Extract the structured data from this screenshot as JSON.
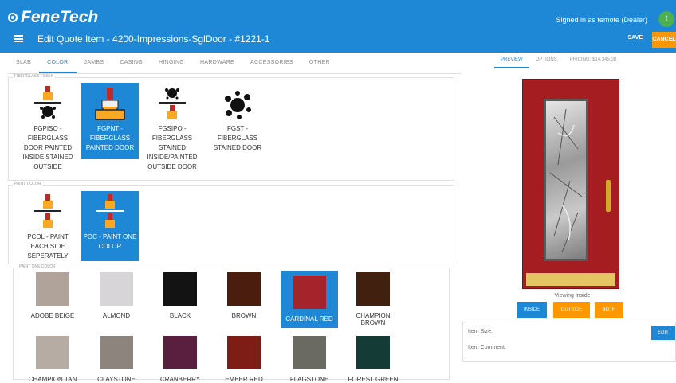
{
  "header": {
    "brand": "FeneTech",
    "signed_in": "Signed in as temote (Dealer)",
    "avatar_initial": "t",
    "page_title": "Edit Quote Item - 4200-Impressions-SglDoor - #1221-1",
    "save_label": "SAVE",
    "cancel_label": "CANCEL"
  },
  "tabs": [
    {
      "label": "SLAB"
    },
    {
      "label": "COLOR"
    },
    {
      "label": "JAMBS"
    },
    {
      "label": "CASING"
    },
    {
      "label": "HINGING"
    },
    {
      "label": "HARDWARE"
    },
    {
      "label": "ACCESSORIES"
    },
    {
      "label": "OTHER"
    }
  ],
  "fiberglass_finish": {
    "label": "FIBERGLASS FINISH",
    "options": [
      {
        "label": "FGPISO - FIBERGLASS DOOR PAINTED INSIDE STAINED OUTSIDE",
        "selected": false
      },
      {
        "label": "FGPNT - FIBERGLASS PAINTED DOOR",
        "selected": true
      },
      {
        "label": "FGSIPO - FIBERGLASS STAINED INSIDE/PAINTED OUTSIDE DOOR",
        "selected": false
      },
      {
        "label": "FGST - FIBERGLASS STAINED DOOR",
        "selected": false
      }
    ]
  },
  "paint_color": {
    "label": "PAINT COLOR",
    "options": [
      {
        "label": "PCOL - PAINT EACH SIDE SEPERATELY",
        "selected": false
      },
      {
        "label": "POC - PAINT ONE COLOR",
        "selected": true
      }
    ]
  },
  "paint_one_color": {
    "label": "PAINT ONE COLOR",
    "swatches": [
      {
        "label": "ADOBE BEIGE",
        "color": "#b0a39a"
      },
      {
        "label": "ALMOND",
        "color": "#d8d5d9"
      },
      {
        "label": "BLACK",
        "color": "#131313"
      },
      {
        "label": "BROWN",
        "color": "#4a1d0f"
      },
      {
        "label": "CARDINAL RED",
        "color": "#a5232b",
        "selected": true
      },
      {
        "label": "CHAMPION BROWN",
        "color": "#412010"
      },
      {
        "label": "CHAMPION TAN",
        "color": "#b6aca4"
      },
      {
        "label": "CLAYSTONE",
        "color": "#8d847e"
      },
      {
        "label": "CRANBERRY",
        "color": "#5a1e3f"
      },
      {
        "label": "EMBER RED",
        "color": "#7e1d16"
      },
      {
        "label": "FLAGSTONE",
        "color": "#6b6a62"
      },
      {
        "label": "FOREST GREEN",
        "color": "#153b36"
      }
    ]
  },
  "right_tabs": [
    {
      "label": "PREVIEW"
    },
    {
      "label": "OPTIONS"
    },
    {
      "label": "PRICING: $14,345.08"
    }
  ],
  "preview": {
    "viewing": "Viewing Inside",
    "buttons": [
      "INSIDE",
      "OUTSIDE",
      "BOTH"
    ],
    "item_size_label": "Item Size:",
    "item_comment_label": "Item Comment:",
    "edit_label": "EDIT"
  },
  "colors": {
    "accent": "#1e88d6",
    "orange": "#ff9800",
    "door_red": "#a51c21"
  }
}
